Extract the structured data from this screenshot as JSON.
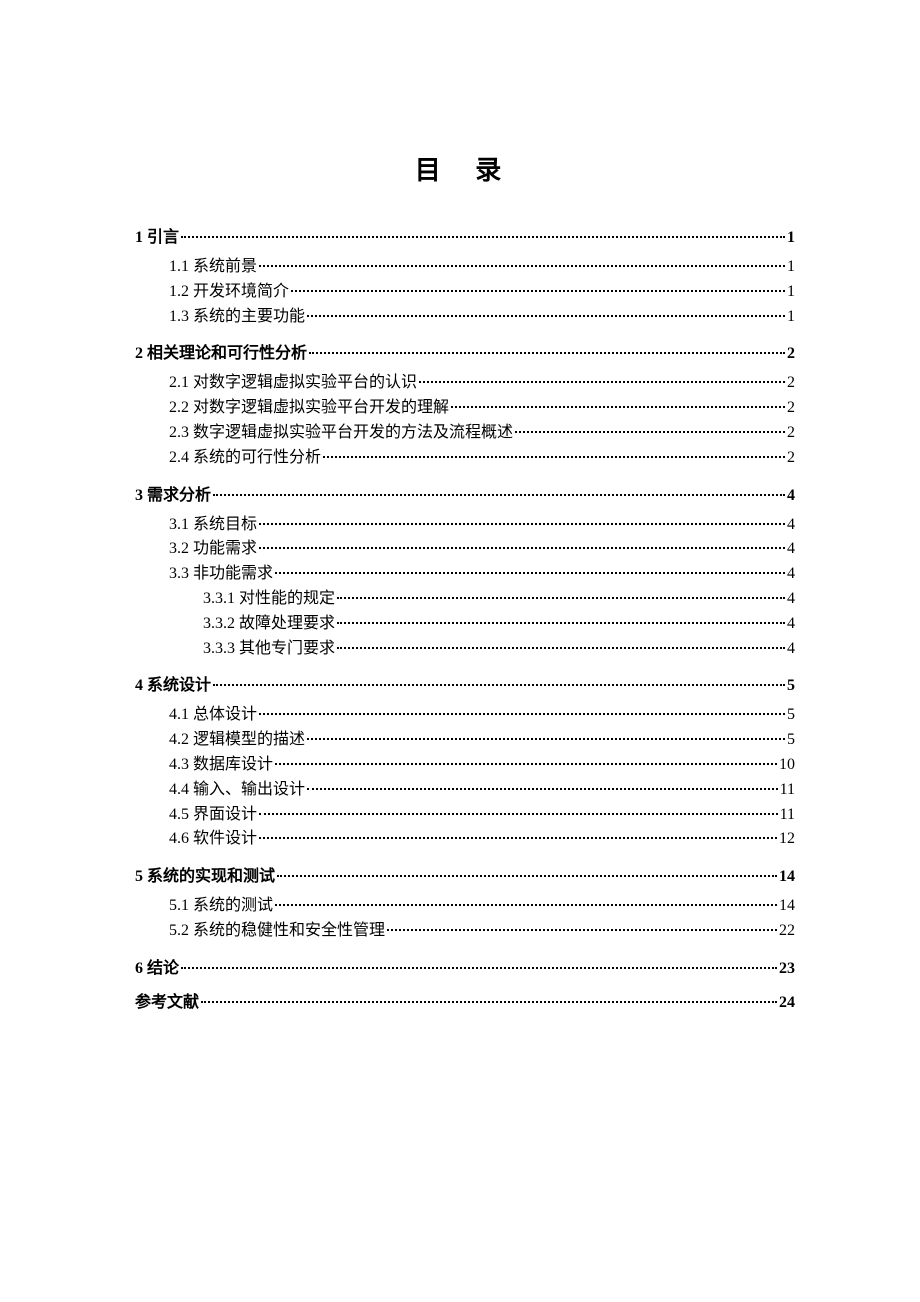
{
  "title": "目 录",
  "toc": [
    {
      "level": 1,
      "label": "1 引言",
      "page": "1"
    },
    {
      "level": 2,
      "label": "1.1 系统前景",
      "page": "1"
    },
    {
      "level": 2,
      "label": "1.2 开发环境简介",
      "page": "1"
    },
    {
      "level": 2,
      "label": "1.3 系统的主要功能",
      "page": "1"
    },
    {
      "level": 1,
      "label": "2  相关理论和可行性分析",
      "page": "2"
    },
    {
      "level": 2,
      "label": "2.1  对数字逻辑虚拟实验平台的认识",
      "page": "2"
    },
    {
      "level": 2,
      "label": "2.2  对数字逻辑虚拟实验平台开发的理解",
      "page": "2"
    },
    {
      "level": 2,
      "label": "2.3  数字逻辑虚拟实验平台开发的方法及流程概述",
      "page": "2"
    },
    {
      "level": 2,
      "label": "2.4  系统的可行性分析",
      "page": "2"
    },
    {
      "level": 1,
      "label": "3  需求分析",
      "page": "4"
    },
    {
      "level": 2,
      "label": "3.1  系统目标",
      "page": "4"
    },
    {
      "level": 2,
      "label": "3.2  功能需求",
      "page": "4"
    },
    {
      "level": 2,
      "label": "3.3  非功能需求",
      "page": "4"
    },
    {
      "level": 3,
      "label": "3.3.1  对性能的规定",
      "page": "4"
    },
    {
      "level": 3,
      "label": "3.3.2 故障处理要求",
      "page": "4"
    },
    {
      "level": 3,
      "label": "3.3.3 其他专门要求",
      "page": "4"
    },
    {
      "level": 1,
      "label": "4 系统设计",
      "page": "5"
    },
    {
      "level": 2,
      "label": "4.1  总体设计",
      "page": "5"
    },
    {
      "level": 2,
      "label": "4.2  逻辑模型的描述",
      "page": "5"
    },
    {
      "level": 2,
      "label": "4.3  数据库设计",
      "page": "10"
    },
    {
      "level": 2,
      "label": "4.4  输入、输出设计",
      "page": "11"
    },
    {
      "level": 2,
      "label": "4.5  界面设计",
      "page": "11"
    },
    {
      "level": 2,
      "label": "4.6  软件设计",
      "page": "12"
    },
    {
      "level": 1,
      "label": "5 系统的实现和测试",
      "page": "14"
    },
    {
      "level": 2,
      "label": "5.1 系统的测试",
      "page": "14"
    },
    {
      "level": 2,
      "label": "5.2  系统的稳健性和安全性管理",
      "page": "22"
    },
    {
      "level": 1,
      "label": "6 结论",
      "page": "23"
    },
    {
      "level": 1,
      "label": "参考文献",
      "page": "24"
    }
  ]
}
